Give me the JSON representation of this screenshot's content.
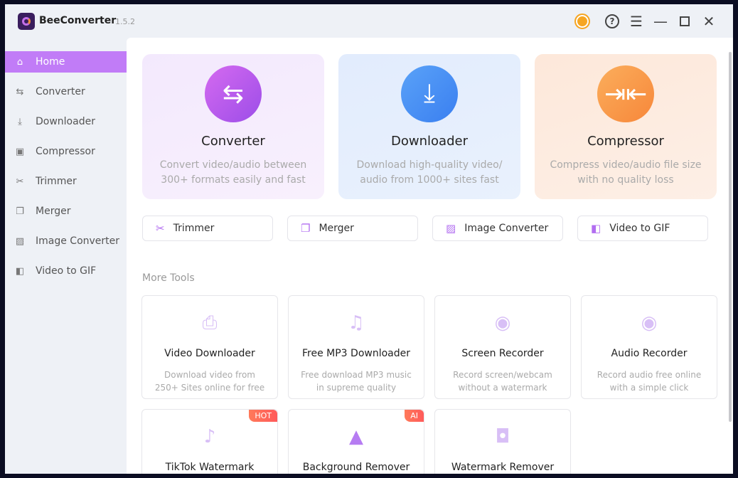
{
  "app": {
    "name": "BeeConverter",
    "version": "1.5.2"
  },
  "sidebar": {
    "items": [
      {
        "label": "Home",
        "icon": "home-icon"
      },
      {
        "label": "Converter",
        "icon": "convert-icon"
      },
      {
        "label": "Downloader",
        "icon": "download-icon"
      },
      {
        "label": "Compressor",
        "icon": "compress-icon"
      },
      {
        "label": "Trimmer",
        "icon": "scissors-icon"
      },
      {
        "label": "Merger",
        "icon": "merge-icon"
      },
      {
        "label": "Image Converter",
        "icon": "image-icon"
      },
      {
        "label": "Video to GIF",
        "icon": "gif-icon"
      }
    ]
  },
  "features": [
    {
      "title": "Converter",
      "desc": "Convert video/audio between 300+ formats easily and fast"
    },
    {
      "title": "Downloader",
      "desc": "Download high-quality video/ audio from 1000+ sites fast"
    },
    {
      "title": "Compressor",
      "desc": "Compress video/audio file size with no quality loss"
    }
  ],
  "quick": [
    "Trimmer",
    "Merger",
    "Image Converter",
    "Video to GIF"
  ],
  "more_tools_label": "More Tools",
  "tools": [
    {
      "title": "Video Downloader",
      "desc1": "Download video from",
      "desc2": "250+ Sites online for free"
    },
    {
      "title": "Free MP3 Downloader",
      "desc1": "Free download MP3 music",
      "desc2": "in supreme quality"
    },
    {
      "title": "Screen Recorder",
      "desc1": "Record screen/webcam",
      "desc2": "without a watermark"
    },
    {
      "title": "Audio Recorder",
      "desc1": "Record audio free online",
      "desc2": "with a simple click"
    },
    {
      "title": "TikTok Watermark",
      "badge": "HOT"
    },
    {
      "title": "Background Remover",
      "badge": "AI"
    },
    {
      "title": "Watermark Remover"
    }
  ]
}
